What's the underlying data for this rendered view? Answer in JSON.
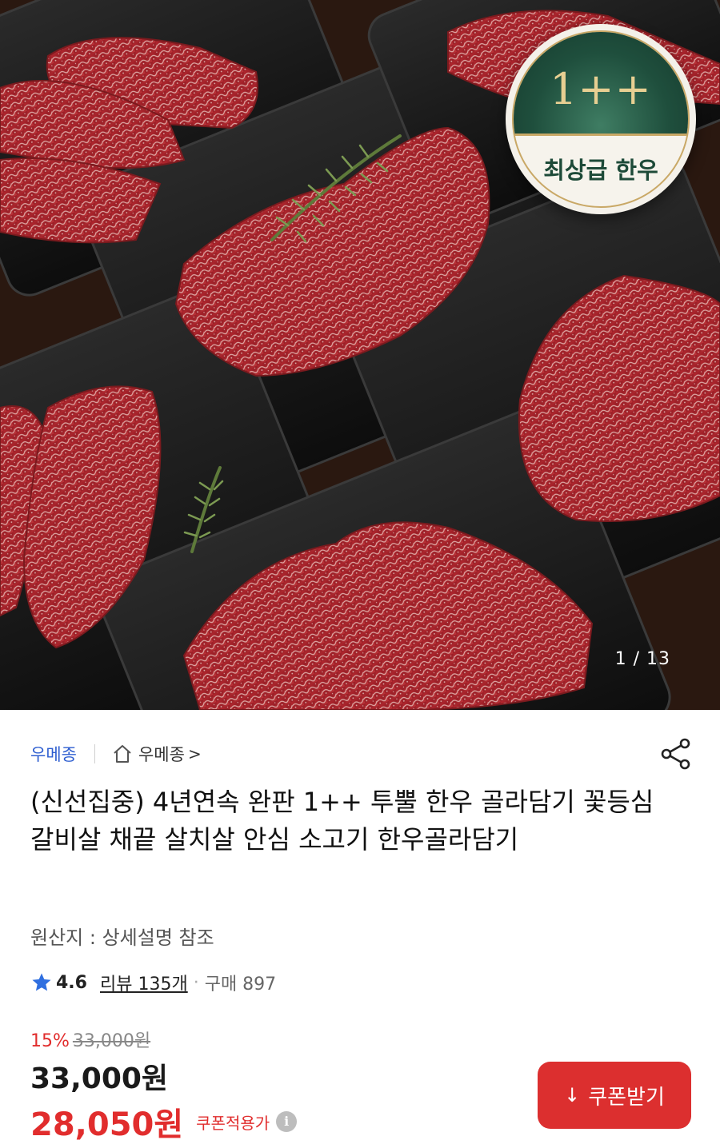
{
  "gallery": {
    "badge_grade": "1++",
    "badge_label": "최상급 한우",
    "counter": "1 / 13"
  },
  "store": {
    "name": "우메종",
    "link_label": "우메종",
    "chevron": ">"
  },
  "product": {
    "title": "(신선집중) 4년연속 완판 1++ 투뿔 한우 골라담기 꽃등심 갈비살 채끝 살치살 안심 소고기 한우골라담기",
    "origin": "원산지 : 상세설명 참조"
  },
  "rating": {
    "score": "4.6",
    "reviews": "리뷰 135개",
    "separator": "·",
    "purchases": "구매 897"
  },
  "price": {
    "discount_rate": "15%",
    "original": "33,000원",
    "current": "33,000원",
    "coupon_price": "28,050원",
    "coupon_note": "쿠폰적용가",
    "info_glyph": "i"
  },
  "coupon_button": {
    "icon": "↓",
    "label": "쿠폰받기"
  },
  "colors": {
    "store_link": "#2f5fd0",
    "sale_red": "#e12d2d",
    "coupon_button": "#dc2f2f",
    "star": "#2f6fe0",
    "badge_green": "#1f4f3d",
    "badge_gold": "#c9a866"
  },
  "icons": [
    "home-icon",
    "share-icon",
    "star-icon",
    "info-icon",
    "download-icon"
  ]
}
